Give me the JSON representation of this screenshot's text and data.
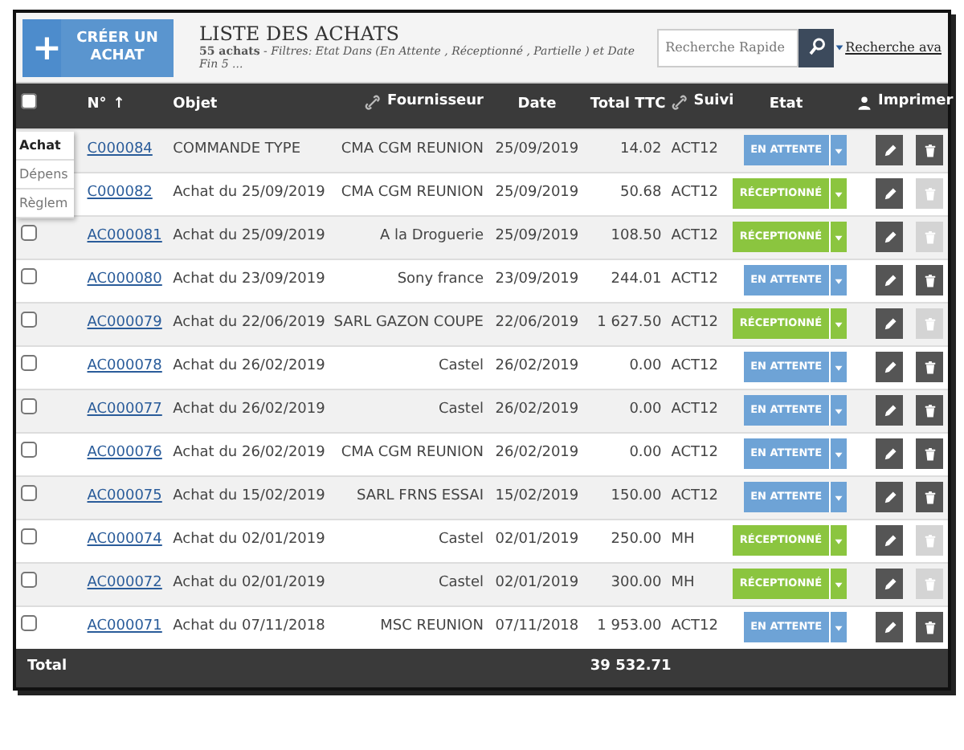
{
  "header": {
    "add_button": "+",
    "create_button": "CRÉER UN ACHAT",
    "title": "LISTE DES ACHATS",
    "subtitle": "**55 achats** - *Filtres: Etat Dans (En Attente , Réceptionné , Partielle ) et Date Fin 5 ...*",
    "search": {
      "placeholder": "Recherche Rapide"
    },
    "advanced_link": "Recherche ava"
  },
  "menu": [
    {
      "label": "Achat",
      "selected": true
    },
    {
      "label": "Dépens",
      "selected": false
    },
    {
      "label": "Règlem",
      "selected": false
    }
  ],
  "table": {
    "header_checkbox": {
      "checked": false
    },
    "columns": [
      {
        "label": "N°",
        "sort": "↑"
      },
      {
        "label": "Objet"
      },
      {
        "label": "Fournisseur"
      },
      {
        "label": "Date"
      },
      {
        "label": "Total TTC"
      },
      {
        "label": "Suivi"
      },
      {
        "label": "Etat"
      },
      {
        "label": "Imprimer"
      }
    ],
    "rows": [
      {
        "number": "C000084",
        "object": "COMMANDE TYPE",
        "supplier": "CMA CGM REUNION",
        "date": "25/09/2019",
        "total": "14.02",
        "tracking": "ACT12",
        "status": {
          "kind": "pending",
          "label": "EN ATTENTE"
        },
        "delete_disabled": false
      },
      {
        "number": "C000082",
        "object": "Achat du 25/09/2019",
        "supplier": "CMA CGM REUNION",
        "date": "25/09/2019",
        "total": "50.68",
        "tracking": "ACT12",
        "status": {
          "kind": "received",
          "label": "RÉCEPTIONNÉ"
        },
        "delete_disabled": true
      },
      {
        "checked": false,
        "number": "AC000081",
        "object": "Achat du 25/09/2019",
        "supplier": "A la Droguerie",
        "date": "25/09/2019",
        "total": "108.50",
        "tracking": "ACT12",
        "status": {
          "kind": "received",
          "label": "RÉCEPTIONNÉ"
        },
        "delete_disabled": true
      },
      {
        "checked": false,
        "number": "AC000080",
        "object": "Achat du 23/09/2019",
        "supplier": "Sony france",
        "date": "23/09/2019",
        "total": "244.01",
        "tracking": "ACT12",
        "status": {
          "kind": "pending",
          "label": "EN ATTENTE"
        },
        "delete_disabled": false
      },
      {
        "checked": false,
        "number": "AC000079",
        "object": "Achat du 22/06/2019",
        "supplier": "SARL GAZON COUPE",
        "date": "22/06/2019",
        "total": "1 627.50",
        "tracking": "ACT12",
        "status": {
          "kind": "received",
          "label": "RÉCEPTIONNÉ"
        },
        "delete_disabled": true
      },
      {
        "checked": false,
        "number": "AC000078",
        "object": "Achat du 26/02/2019",
        "supplier": "Castel",
        "date": "26/02/2019",
        "total": "0.00",
        "tracking": "ACT12",
        "status": {
          "kind": "pending",
          "label": "EN ATTENTE"
        },
        "delete_disabled": false
      },
      {
        "checked": false,
        "number": "AC000077",
        "object": "Achat du 26/02/2019",
        "supplier": "Castel",
        "date": "26/02/2019",
        "total": "0.00",
        "tracking": "ACT12",
        "status": {
          "kind": "pending",
          "label": "EN ATTENTE"
        },
        "delete_disabled": false
      },
      {
        "checked": false,
        "number": "AC000076",
        "object": "Achat du 26/02/2019",
        "supplier": "CMA CGM REUNION",
        "date": "26/02/2019",
        "total": "0.00",
        "tracking": "ACT12",
        "status": {
          "kind": "pending",
          "label": "EN ATTENTE"
        },
        "delete_disabled": false
      },
      {
        "checked": false,
        "number": "AC000075",
        "object": "Achat du 15/02/2019",
        "supplier": "SARL FRNS ESSAI",
        "date": "15/02/2019",
        "total": "150.00",
        "tracking": "ACT12",
        "status": {
          "kind": "pending",
          "label": "EN ATTENTE"
        },
        "delete_disabled": false
      },
      {
        "checked": false,
        "number": "AC000074",
        "object": "Achat du 02/01/2019",
        "supplier": "Castel",
        "date": "02/01/2019",
        "total": "250.00",
        "tracking": "MH",
        "status": {
          "kind": "received",
          "label": "RÉCEPTIONNÉ"
        },
        "delete_disabled": true
      },
      {
        "checked": false,
        "number": "AC000072",
        "object": "Achat du 02/01/2019",
        "supplier": "Castel",
        "date": "02/01/2019",
        "total": "300.00",
        "tracking": "MH",
        "status": {
          "kind": "received",
          "label": "RÉCEPTIONNÉ"
        },
        "delete_disabled": true
      },
      {
        "checked": false,
        "number": "AC000071",
        "object": "Achat du 07/11/2018",
        "supplier": "MSC REUNION",
        "date": "07/11/2018",
        "total": "1 953.00",
        "tracking": "ACT12",
        "status": {
          "kind": "pending",
          "label": "EN ATTENTE"
        },
        "delete_disabled": false
      }
    ],
    "footer": {
      "label": "Total",
      "total": "39 532.71"
    }
  }
}
